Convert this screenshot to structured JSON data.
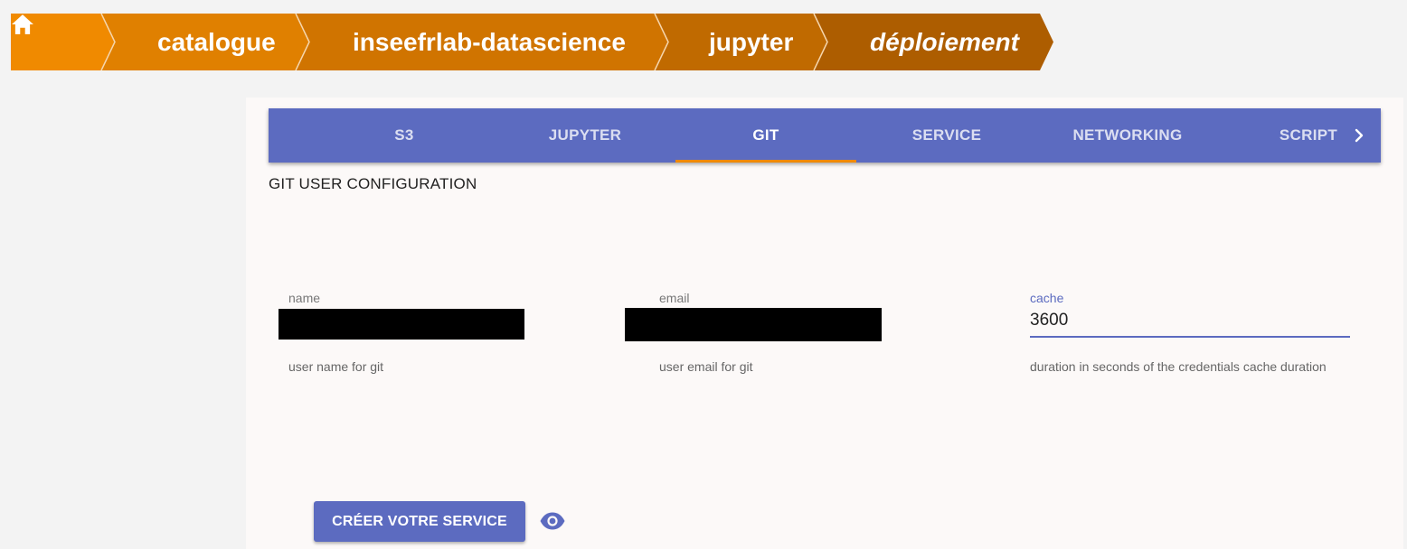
{
  "breadcrumb": {
    "home_icon": "home-icon",
    "items": [
      {
        "label": "catalogue",
        "color": "#e08000"
      },
      {
        "label": "inseefrlab-datascience",
        "color": "#d07400"
      },
      {
        "label": "jupyter",
        "color": "#c06a00"
      },
      {
        "label": "déploiement",
        "color": "#ad5d00"
      }
    ],
    "home_color": "#f08a00"
  },
  "tabs": {
    "items": [
      "S3",
      "JUPYTER",
      "GIT",
      "SERVICE",
      "NETWORKING",
      "SCRIPT"
    ],
    "active": "GIT",
    "next_icon": "chevron-right-icon",
    "color": "#5c6bc0",
    "indicator_color": "#f08a00"
  },
  "section": {
    "title": "GIT USER CONFIGURATION"
  },
  "fields": {
    "name": {
      "label": "name",
      "value": "",
      "help": "user name for git"
    },
    "email": {
      "label": "email",
      "value": "",
      "help": "user email for git"
    },
    "cache": {
      "label": "cache",
      "value": "3600",
      "help": "duration in seconds of the credentials cache duration"
    }
  },
  "actions": {
    "create_label": "CRÉER VOTRE SERVICE",
    "preview_icon": "eye-icon"
  }
}
